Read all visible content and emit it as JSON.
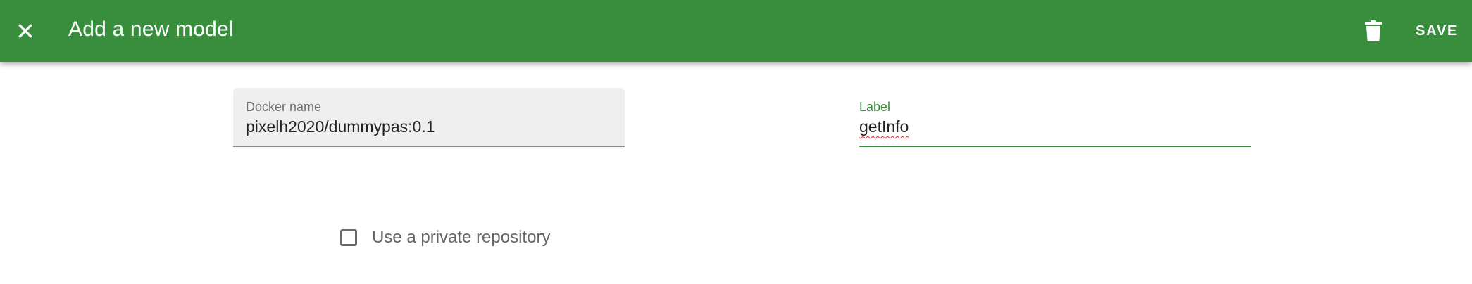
{
  "appbar": {
    "title": "Add a new model",
    "save_label": "SAVE",
    "close_icon": "close-icon",
    "delete_icon": "trash-icon",
    "background_color": "#388e3c"
  },
  "form": {
    "docker_name": {
      "label": "Docker name",
      "value": "pixelh2020/dummypas:0.1"
    },
    "label_field": {
      "label": "Label",
      "value": "getInfo",
      "accent_color": "#388e3c"
    },
    "private_repo": {
      "label": "Use a private repository",
      "checked": false
    }
  }
}
